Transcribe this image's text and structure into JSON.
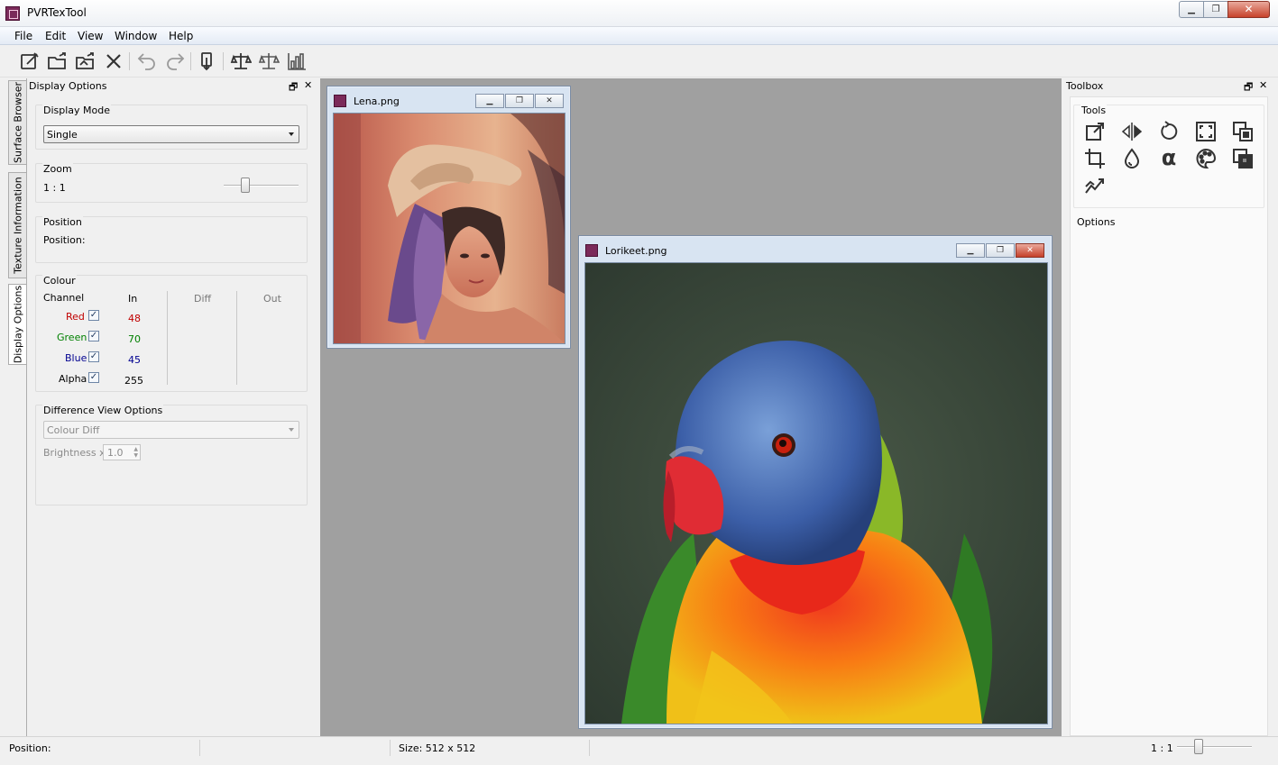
{
  "window": {
    "title": "PVRTexTool",
    "min": "▁",
    "max": "❐",
    "close": "✕"
  },
  "menu": [
    "File",
    "Edit",
    "View",
    "Window",
    "Help"
  ],
  "toolbar": {
    "icons": [
      "new-icon",
      "open-icon",
      "open-folder-icon",
      "close-icon",
      "undo-icon",
      "redo-icon",
      "encode-icon",
      "compare-icon",
      "compare-alt-icon",
      "histogram-icon"
    ]
  },
  "side_tabs": [
    "Surface Browser",
    "Texture Information",
    "Display Options"
  ],
  "display_options": {
    "title": "Display Options",
    "float": "🗗",
    "close": "✕",
    "display_mode": {
      "label": "Display Mode",
      "value": "Single"
    },
    "zoom": {
      "label": "Zoom",
      "value": "1 : 1",
      "level": 0.26
    },
    "position": {
      "label": "Position",
      "text": "Position:"
    },
    "colour": {
      "label": "Colour",
      "headers": {
        "channel": "Channel",
        "in": "In",
        "diff": "Diff",
        "out": "Out"
      },
      "rows": [
        {
          "name": "Red",
          "value": "48",
          "color": "#c00000",
          "checked": true
        },
        {
          "name": "Green",
          "value": "70",
          "color": "#008000",
          "checked": true
        },
        {
          "name": "Blue",
          "value": "45",
          "color": "#000090",
          "checked": true
        },
        {
          "name": "Alpha",
          "value": "255",
          "color": "#000000",
          "checked": true
        }
      ],
      "check": "✓"
    },
    "difference": {
      "label": "Difference View Options",
      "mode": "Colour Diff",
      "brightness_label": "Brightness x",
      "brightness_value": "1.0"
    }
  },
  "mdi_windows": [
    {
      "title": "Lena.png",
      "min": "▁",
      "max": "❐",
      "close": "✕"
    },
    {
      "title": "Lorikeet.png",
      "min": "▁",
      "max": "❐",
      "close": "✕"
    }
  ],
  "toolbox": {
    "title": "Toolbox",
    "float": "🗗",
    "close": "✕",
    "tools_label": "Tools",
    "options_label": "Options",
    "alpha": "α",
    "tools": [
      "resize-icon",
      "flip-icon",
      "rotate-icon",
      "border-icon",
      "pre-multiply-icon",
      "crop-icon",
      "channel-icon",
      "alpha-icon",
      "colour-icon",
      "normal-map-icon",
      "mipmap-icon"
    ]
  },
  "status": {
    "position": "Position:",
    "size": "Size: 512 x 512",
    "zoom": "1 : 1",
    "zoom_level": 0.26
  },
  "colors": {
    "accent": "#7b2a5a",
    "mdi_bg": "#a0a0a0"
  }
}
